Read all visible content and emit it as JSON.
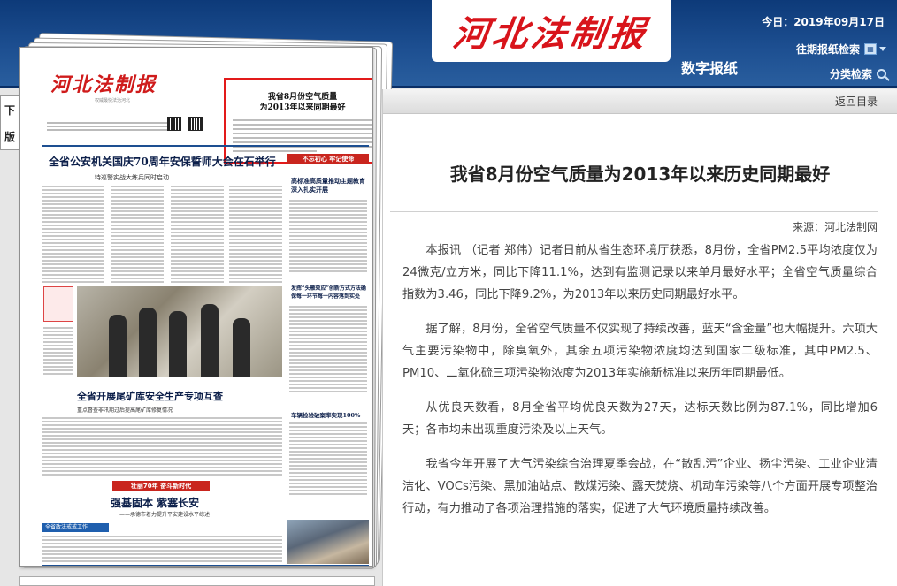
{
  "header": {
    "logo_text": "河北法制报",
    "digital_label": "数字报纸",
    "today": "今日：2019年09月17日",
    "past_issue_link": "往期报纸检索",
    "category_search_link": "分类检索",
    "brand_color": "#1d4f91",
    "logo_color": "#d8141b"
  },
  "side_tab": {
    "chars": [
      "下",
      "版"
    ]
  },
  "newspaper": {
    "masthead": "河北法制报",
    "slogan": "权威最快法治河北",
    "boxed_headline_line1": "我省8月份空气质量",
    "boxed_headline_line2": "为2013年以来同期最好",
    "headline1": "全省公安机关国庆70周年安保誓师大会在石举行",
    "subheadline1": "特巡警实战大练兵同时启动",
    "right_column_band": "不忘初心 牢记使命",
    "right_headline_a": "高标准高质量推动主题教育深入扎实开展",
    "right_headline_b": "发挥“头雁效应”创新方式方法确保每一环节每一内容落到实处",
    "right_headline_c": "车辆检验破案率实现100%",
    "headline2": "全省开展尾矿库安全生产专项互查",
    "subheadline2": "重点督查非汛期过后提高尾矿库修复情况",
    "red_band": "壮丽70年 奋斗新时代",
    "headline3": "强基固本 紫塞长安",
    "subheadline3": "——承德市着力提升平安建设水平综述",
    "blue_band": "全省政法戒戒工作"
  },
  "article": {
    "return_label": "返回目录",
    "title": "我省8月份空气质量为2013年以来历史同期最好",
    "source": "来源：河北法制网",
    "paragraphs": [
      "本报讯 （记者 郑伟）记者日前从省生态环境厅获悉，8月份，全省PM2.5平均浓度仅为24微克/立方米，同比下降11.1%，达到有监测记录以来单月最好水平；全省空气质量综合指数为3.46，同比下降9.2%，为2013年以来历史同期最好水平。",
      "据了解，8月份，全省空气质量不仅实现了持续改善，蓝天“含金量”也大幅提升。六项大气主要污染物中，除臭氧外，其余五项污染物浓度均达到国家二级标准，其中PM2.5、PM10、二氧化硫三项污染物浓度为2013年实施新标准以来历年同期最低。",
      "从优良天数看，8月全省平均优良天数为27天，达标天数比例为87.1%，同比增加6天；各市均未出现重度污染及以上天气。",
      "我省今年开展了大气污染综合治理夏季会战，在“散乱污”企业、扬尘污染、工业企业清洁化、VOCs污染、黑加油站点、散煤污染、露天焚烧、机动车污染等八个方面开展专项整治行动，有力推动了各项治理措施的落实，促进了大气环境质量持续改善。"
    ]
  }
}
